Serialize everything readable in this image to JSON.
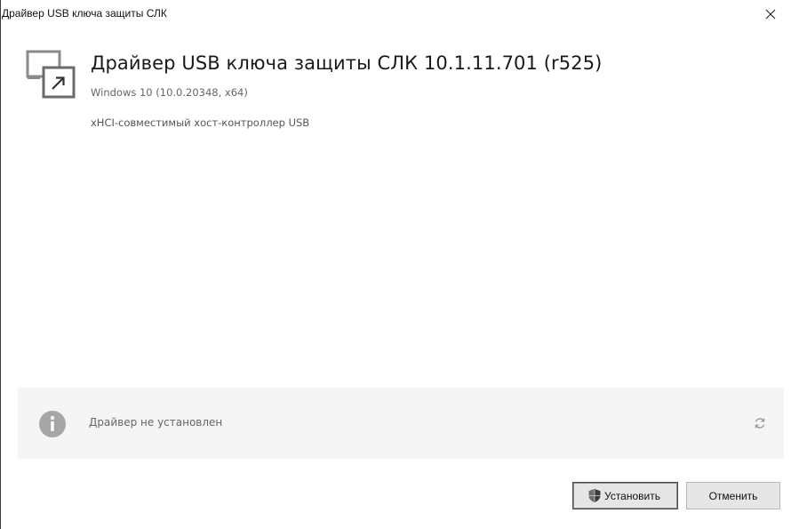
{
  "window": {
    "title": "Драйвер USB ключа защиты СЛК"
  },
  "header": {
    "title": "Драйвер USB ключа защиты СЛК 10.1.11.701 (r525)",
    "os_info": "Windows 10 (10.0.20348, x64)",
    "description": "xHCI-совместимый хост-контроллер USB",
    "icon": "app-shortcut-icon"
  },
  "status": {
    "icon": "info-icon",
    "text": "Драйвер не установлен",
    "refresh_icon": "refresh-icon"
  },
  "buttons": {
    "install_label": "Установить",
    "install_icon": "uac-shield-icon",
    "cancel_label": "Отменить"
  }
}
